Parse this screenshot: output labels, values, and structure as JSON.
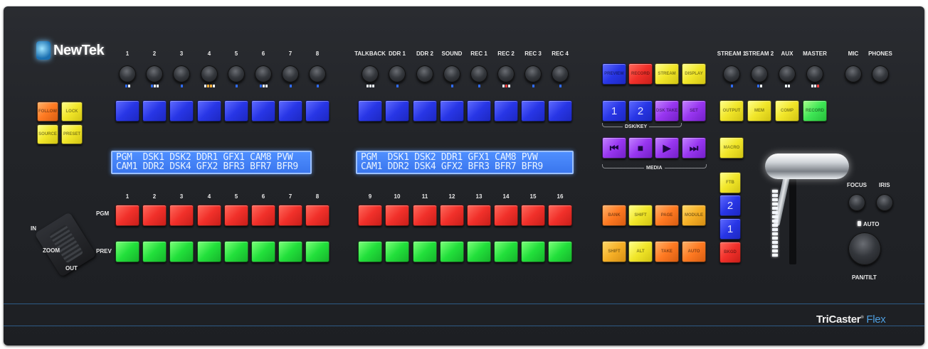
{
  "brand_logo": "NewTek",
  "product": {
    "name": "TriCaster",
    "edition": "Flex"
  },
  "aux_left_labels": [
    "1",
    "2",
    "3",
    "4",
    "5",
    "6",
    "7",
    "8"
  ],
  "aux_right_labels": [
    "TALKBACK",
    "DDR 1",
    "DDR 2",
    "SOUND",
    "REC 1",
    "REC 2",
    "REC 3",
    "REC 4"
  ],
  "output_labels": [
    "STREAM 1",
    "STREAM 2",
    "AUX",
    "MASTER"
  ],
  "mic_labels": [
    "MIC",
    "PHONES"
  ],
  "follow_buttons": [
    "FOLLOW",
    "LOCK",
    "SOURCE",
    "PRESET"
  ],
  "lcd_left": {
    "line1": "PGM  DSK1 DSK2 DDR1 GFX1 CAM8 PVW",
    "line2": "CAM1 DDR2 DSK4 GFX2 BFR3 BFR7 BFR9"
  },
  "lcd_right": {
    "line1": "PGM  DSK1 DSK2 DDR1 GFX1 CAM8 PVW",
    "line2": "CAM1 DDR2 DSK4 GFX2 BFR3 BFR7 BFR9"
  },
  "bus_numbers_left": [
    "1",
    "2",
    "3",
    "4",
    "5",
    "6",
    "7",
    "8"
  ],
  "bus_numbers_right": [
    "9",
    "10",
    "11",
    "12",
    "13",
    "14",
    "15",
    "16"
  ],
  "row_labels": {
    "pgm": "PGM",
    "prev": "PREV"
  },
  "zoom": {
    "in": "IN",
    "zoom": "ZOOM",
    "out": "OUT"
  },
  "delegate_top": [
    "PREVIEW",
    "RECORD",
    "STREAM",
    "DISPLAY"
  ],
  "dsk_buttons": [
    "1",
    "2",
    "DSK TAKE",
    "SET"
  ],
  "dsk_label": "DSK/KEY",
  "media_label": "MEDIA",
  "media_buttons": [
    "prev-icon",
    "stop-icon",
    "play-icon",
    "next-icon"
  ],
  "macro_label": "MACRO",
  "transition_column": [
    "FTB",
    "2",
    "1",
    "BKGD"
  ],
  "output_buttons": [
    "OUTPUT",
    "MEM",
    "COMP",
    "RECORD"
  ],
  "bank_row1": [
    "BANK",
    "SHIFT",
    "PAGE",
    "MODULE"
  ],
  "bank_row2": [
    "SHIFT",
    "ALT",
    "TAKE",
    "AUTO"
  ],
  "camera": {
    "focus": "FOCUS",
    "iris": "IRIS",
    "auto": "AUTO",
    "pantilt": "PAN/TILT"
  },
  "colors": {
    "panel": "#222428",
    "accent": "#4f9fe0",
    "lcd": "#3a76ee"
  }
}
